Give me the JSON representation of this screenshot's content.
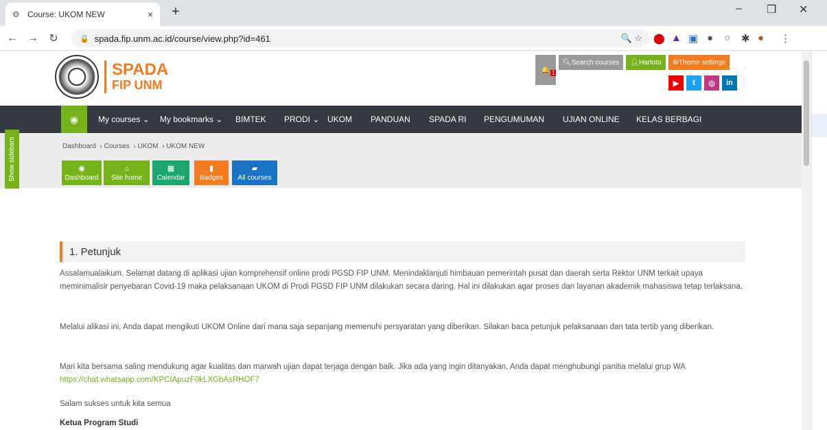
{
  "browser": {
    "tab_title": "Course: UKOM NEW",
    "tab_close": "×",
    "new_tab": "+",
    "url": "spada.fip.unm.ac.id/course/view.php?id=461",
    "minimize": "–",
    "restore": "❐",
    "close": "✕"
  },
  "site": {
    "logo_line1": "SPADA",
    "logo_line2": "FIP UNM",
    "search_courses": "Search courses",
    "user": "Hartoto",
    "theme_settings": "Theme settings",
    "notification_count": "1"
  },
  "nav": {
    "items": [
      "My courses ⌄",
      "My bookmarks ⌄",
      "BIMTEK",
      "PRODI ⌄",
      "UKOM",
      "PANDUAN",
      "SPADA RI",
      "PENGUMUMAN",
      "UJIAN ONLINE",
      "KELAS BERBAGI"
    ]
  },
  "breadcrumb": {
    "items": [
      "Dashboard",
      "Courses",
      "UKOM",
      "UKOM NEW"
    ]
  },
  "quick": {
    "dashboard": "Dashboard",
    "site_home": "Site home",
    "calendar": "Calendar",
    "badges": "Badges",
    "all_courses": "All courses"
  },
  "sidebar_toggle": "Show sidebars",
  "section": {
    "title": "1. Petunjuk",
    "p1": "Assalamualaikum. Selamat datang di aplikasi ujian komprehensif online prodi PGSD FIP UNM. Menindaklanjuti himbauan pemerintah pusat dan daerah serta Rektor UNM terkait upaya meminimalisir penyebaran Covid-19 maka pelaksanaan UKOM di Prodi PGSD FIP UNM dilakukan secara daring. Hal ini dilakukan agar proses dan layanan akademik mahasiswa tetap terlaksana.",
    "p2": "Melalui alikasi ini, Anda dapat mengikuti UKOM Online dari mana saja sepanjang memenuhi persyaratan yang diberikan. Silakan baca petunjuk pelaksanaan dan tata tertib yang diberikan.",
    "p3_text": "Mari kita bersama saling mendukung agar kualitas dan marwah ujian dapat terjaga dengan baik. Jika ada yang ingin ditanyakan, Anda dapat menghubungi panitia melalui grup WA ",
    "p3_link": "https://chat.whatsapp.com/KPCtApuzF0kLXGbAsRHOF7",
    "p4": "Salam sukses untuk kita semua",
    "p5": "Ketua Program Studi"
  }
}
